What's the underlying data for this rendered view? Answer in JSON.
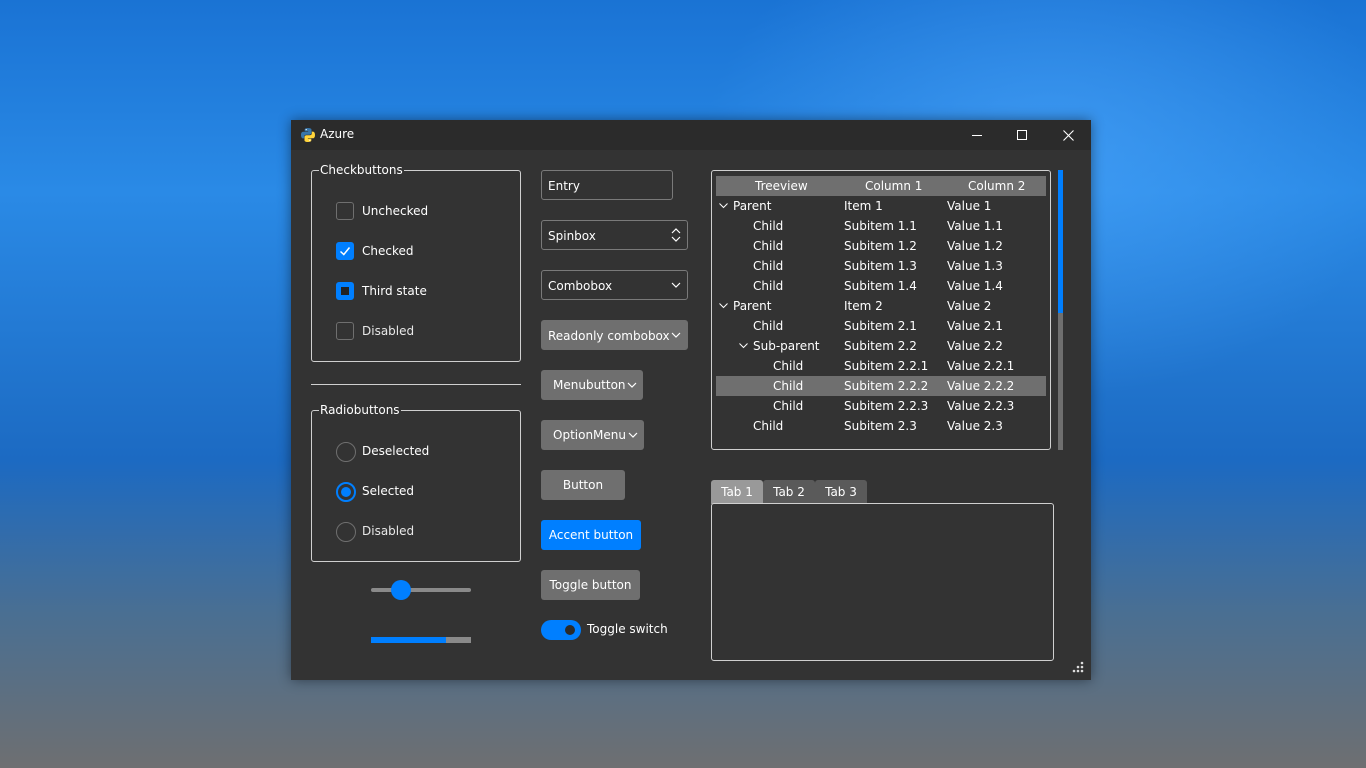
{
  "window": {
    "title": "Azure",
    "accent_color": "#007fff"
  },
  "checkbuttons": {
    "frame_label": "Checkbuttons",
    "items": [
      {
        "label": "Unchecked",
        "state": "unchecked"
      },
      {
        "label": "Checked",
        "state": "checked"
      },
      {
        "label": "Third state",
        "state": "indeterminate"
      },
      {
        "label": "Disabled",
        "state": "disabled"
      }
    ]
  },
  "radiobuttons": {
    "frame_label": "Radiobuttons",
    "items": [
      {
        "label": "Deselected",
        "state": "deselected"
      },
      {
        "label": "Selected",
        "state": "selected"
      },
      {
        "label": "Disabled",
        "state": "disabled"
      }
    ]
  },
  "scale": {
    "value": 0.3
  },
  "progress": {
    "value": 0.75
  },
  "inputs": {
    "entry": "Entry",
    "spinbox": "Spinbox",
    "combobox": "Combobox",
    "readonly_combobox": "Readonly combobox"
  },
  "buttons": {
    "menubutton": "Menubutton",
    "optionmenu": "OptionMenu",
    "button": "Button",
    "accent_button": "Accent button",
    "toggle_button": "Toggle button",
    "toggle_switch": "Toggle switch"
  },
  "treeview": {
    "columns": [
      "Treeview",
      "Column 1",
      "Column 2"
    ],
    "rows": [
      {
        "name": "Parent",
        "col1": "Item 1",
        "col2": "Value 1",
        "level": 0,
        "expanded": true
      },
      {
        "name": "Child",
        "col1": "Subitem 1.1",
        "col2": "Value 1.1",
        "level": 1
      },
      {
        "name": "Child",
        "col1": "Subitem 1.2",
        "col2": "Value 1.2",
        "level": 1
      },
      {
        "name": "Child",
        "col1": "Subitem 1.3",
        "col2": "Value 1.3",
        "level": 1
      },
      {
        "name": "Child",
        "col1": "Subitem 1.4",
        "col2": "Value 1.4",
        "level": 1
      },
      {
        "name": "Parent",
        "col1": "Item 2",
        "col2": "Value 2",
        "level": 0,
        "expanded": true
      },
      {
        "name": "Child",
        "col1": "Subitem 2.1",
        "col2": "Value 2.1",
        "level": 1
      },
      {
        "name": "Sub-parent",
        "col1": "Subitem 2.2",
        "col2": "Value 2.2",
        "level": 1,
        "expanded": true
      },
      {
        "name": "Child",
        "col1": "Subitem 2.2.1",
        "col2": "Value 2.2.1",
        "level": 2
      },
      {
        "name": "Child",
        "col1": "Subitem 2.2.2",
        "col2": "Value 2.2.2",
        "level": 2,
        "selected": true
      },
      {
        "name": "Child",
        "col1": "Subitem 2.2.3",
        "col2": "Value 2.2.3",
        "level": 2
      },
      {
        "name": "Child",
        "col1": "Subitem 2.3",
        "col2": "Value 2.3",
        "level": 1
      }
    ]
  },
  "tabs": [
    "Tab 1",
    "Tab 2",
    "Tab 3"
  ]
}
